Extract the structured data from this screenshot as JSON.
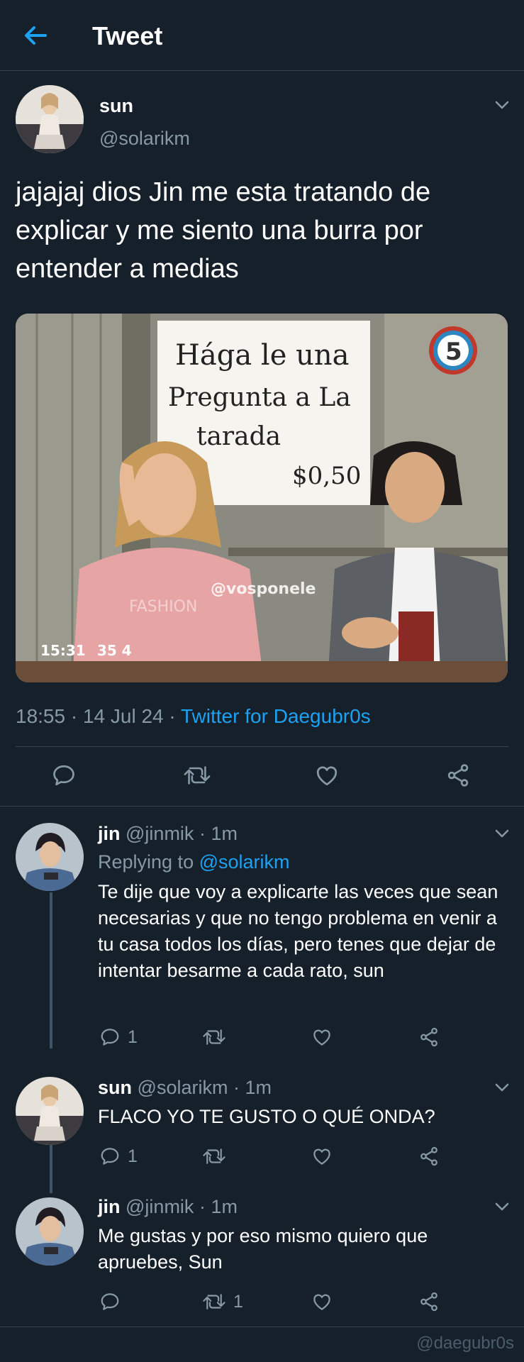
{
  "header": {
    "title": "Tweet"
  },
  "main_tweet": {
    "name": "sun",
    "handle": "@solarikm",
    "text": "jajajaj dios Jin me esta tratando de explicar y me siento una burra por entender a medias",
    "media": {
      "sign_line1": "Hága le una",
      "sign_line2": "Pregunta a La",
      "sign_line3": "tarada",
      "sign_price": "$0,50",
      "channel": "5",
      "watermark": "@vosponele",
      "jacket_text": "FASHION",
      "timestamp": "15:31",
      "timestamp2": "35 4"
    },
    "time": "18:55",
    "date": "14 Jul 24",
    "source": "Twitter for Daegubr0s"
  },
  "replies": [
    {
      "name": "jin",
      "handle": "@jinmik",
      "time": "1m",
      "replying_label": "Replying to",
      "replying_to": "@solarikm",
      "text": "Te dije que voy a explicarte las veces que sean necesarias y que no tengo problema en venir a tu casa todos los días, pero tenes que dejar de intentar besarme a cada rato, sun",
      "reply_count": "1",
      "retweet_count": ""
    },
    {
      "name": "sun",
      "handle": "@solarikm",
      "time": "1m",
      "text": "FLACO YO TE GUSTO O QUÉ ONDA?",
      "reply_count": "1",
      "retweet_count": ""
    },
    {
      "name": "jin",
      "handle": "@jinmik",
      "time": "1m",
      "text": "Me gustas y por eso mismo quiero que apruebes, Sun",
      "reply_count": "",
      "retweet_count": "1"
    }
  ],
  "watermark": "@daegubr0s",
  "colors": {
    "background": "#15202b",
    "accent": "#1da1f2",
    "muted": "#8899a6",
    "divider": "#38444d"
  }
}
